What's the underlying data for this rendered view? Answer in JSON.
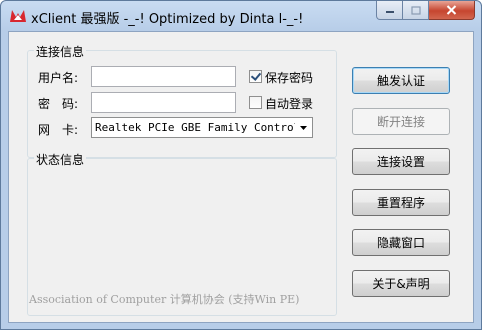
{
  "window": {
    "title": "xClient 最强版 -_-! Optimized by Dinta l-_-!"
  },
  "connection_group": {
    "label": "连接信息",
    "username_label": "用户名:",
    "username_value": "",
    "password_label": "密　码:",
    "password_value": "",
    "nic_label": "网　卡:",
    "nic_value": "Realtek PCIe GBE Family Controlle",
    "save_password_label": "保存密码",
    "save_password_checked": true,
    "auto_login_label": "自动登录",
    "auto_login_checked": false
  },
  "status_group": {
    "label": "状态信息",
    "footer": "Association of Computer 计算机协会 (支持Win PE)"
  },
  "buttons": {
    "auth": "触发认证",
    "disconnect": "断开连接",
    "settings": "连接设置",
    "restart": "重置程序",
    "hide": "隐藏窗口",
    "about": "关于&声明"
  },
  "colors": {
    "accent_default_button": "#3c7fb1",
    "close_button": "#c6452f",
    "disabled_text": "#838383"
  }
}
